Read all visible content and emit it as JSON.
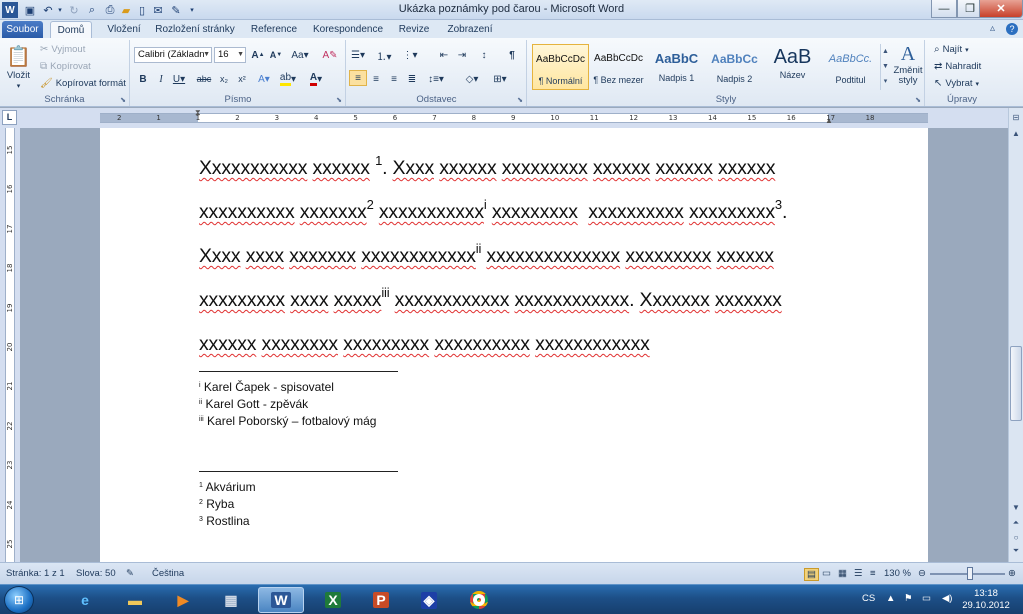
{
  "window": {
    "title": "Ukázka poznámky pod čarou - Microsoft Word",
    "controls": [
      "minimize-icon",
      "maximize-icon",
      "close-icon"
    ]
  },
  "tabs": [
    {
      "label": "Soubor"
    },
    {
      "label": "Domů"
    },
    {
      "label": "Vložení"
    },
    {
      "label": "Rozložení stránky"
    },
    {
      "label": "Reference"
    },
    {
      "label": "Korespondence"
    },
    {
      "label": "Revize"
    },
    {
      "label": "Zobrazení"
    }
  ],
  "ribbon": {
    "clipboard": {
      "label": "Schránka",
      "paste": "Vložit",
      "cut": "Vyjmout",
      "copy": "Kopírovat",
      "format_painter": "Kopírovat formát"
    },
    "font": {
      "label": "Písmo",
      "font_name": "Calibri (Základn",
      "font_size": "16"
    },
    "paragraph": {
      "label": "Odstavec"
    },
    "styles": {
      "label": "Styly",
      "items": [
        {
          "preview": "AaBbCcDc",
          "name": "¶ Normální"
        },
        {
          "preview": "AaBbCcDc",
          "name": "¶ Bez mezer"
        },
        {
          "preview": "AaBbC",
          "name": "Nadpis 1"
        },
        {
          "preview": "AaBbCc",
          "name": "Nadpis 2"
        },
        {
          "preview": "AaB",
          "name": "Název"
        },
        {
          "preview": "AaBbCc.",
          "name": "Podtitul"
        }
      ],
      "change_styles": "Změnit styly"
    },
    "editing": {
      "label": "Úpravy",
      "find": "Najít",
      "replace": "Nahradit",
      "select": "Vybrat"
    }
  },
  "ruler": {
    "ticks": [
      "2",
      "1",
      "1",
      "2",
      "3",
      "4",
      "5",
      "6",
      "7",
      "8",
      "9",
      "10",
      "11",
      "12",
      "13",
      "14",
      "15",
      "16",
      "17",
      "18"
    ],
    "vticks": [
      "15",
      "16",
      "17",
      "18",
      "19",
      "20",
      "21",
      "22",
      "23",
      "24",
      "25"
    ]
  },
  "document": {
    "lines": [
      [
        {
          "t": "Xxxxxxxxxxx"
        },
        {
          "t": " "
        },
        {
          "t": "xxxxxx"
        },
        {
          "t": " "
        },
        {
          "sup": "1"
        },
        {
          "t": ". "
        },
        {
          "t": "Xxxx"
        },
        {
          "t": " "
        },
        {
          "t": "xxxxxx"
        },
        {
          "t": " "
        },
        {
          "t": "xxxxxxxxx"
        },
        {
          "t": " "
        },
        {
          "t": "xxxxxx"
        },
        {
          "t": " "
        },
        {
          "t": "xxxxxx"
        },
        {
          "t": " "
        },
        {
          "t": "xxxxxx"
        }
      ],
      [
        {
          "t": "xxxxxxxxxx"
        },
        {
          "t": " "
        },
        {
          "t": "xxxxxxx"
        },
        {
          "sup": "2"
        },
        {
          "t": " "
        },
        {
          "t": "xxxxxxxxxxx"
        },
        {
          "sup": "i"
        },
        {
          "t": " "
        },
        {
          "t": "xxxxxxxxx"
        },
        {
          "t": "  "
        },
        {
          "t": "xxxxxxxxxx"
        },
        {
          "t": " "
        },
        {
          "t": "xxxxxxxxx"
        },
        {
          "sup": "3"
        },
        {
          "t": "."
        }
      ],
      [
        {
          "t": "Xxxx"
        },
        {
          "t": " "
        },
        {
          "t": "xxxx"
        },
        {
          "t": " "
        },
        {
          "t": "xxxxxxx"
        },
        {
          "t": " "
        },
        {
          "t": "xxxxxxxxxxxx"
        },
        {
          "sup": "ii"
        },
        {
          "t": " "
        },
        {
          "t": "xxxxxxxxxxxxxx"
        },
        {
          "t": " "
        },
        {
          "t": "xxxxxxxxx"
        },
        {
          "t": " "
        },
        {
          "t": "xxxxxx"
        }
      ],
      [
        {
          "t": "xxxxxxxxx"
        },
        {
          "t": " "
        },
        {
          "t": "xxxx"
        },
        {
          "t": " "
        },
        {
          "t": "xxxxx"
        },
        {
          "sup": "iii"
        },
        {
          "t": " "
        },
        {
          "t": "xxxxxxxxxxxx"
        },
        {
          "t": " "
        },
        {
          "t": "xxxxxxxxxxxx"
        },
        {
          "t": ". "
        },
        {
          "t": "Xxxxxxx"
        },
        {
          "t": " "
        },
        {
          "t": "xxxxxxx"
        }
      ],
      [
        {
          "t": "xxxxxx"
        },
        {
          "t": " "
        },
        {
          "t": "xxxxxxxx"
        },
        {
          "t": " "
        },
        {
          "t": "xxxxxxxxx"
        },
        {
          "t": " "
        },
        {
          "t": "xxxxxxxxxx"
        },
        {
          "t": " "
        },
        {
          "t": "xxxxxxxxxxxx"
        }
      ]
    ],
    "endnotes": [
      {
        "mark": "i",
        "text": "Karel Čapek - spisovatel"
      },
      {
        "mark": "ii",
        "text": "Karel Gott - zpěvák"
      },
      {
        "mark": "iii",
        "text": "Karel Poborský – fotbalový mág"
      }
    ],
    "footnotes": [
      {
        "mark": "1",
        "text": "Akvárium"
      },
      {
        "mark": "2",
        "text": "Ryba"
      },
      {
        "mark": "3",
        "text": "Rostlina"
      }
    ]
  },
  "statusbar": {
    "page": "Stránka: 1 z 1",
    "words": "Slova: 50",
    "language": "Čeština",
    "zoom": "130 %",
    "zoom_value": 130
  },
  "taskbar": {
    "apps": [
      "internet-explorer-icon",
      "explorer-icon",
      "media-player-icon",
      "calculator-icon",
      "word-icon",
      "excel-icon",
      "powerpoint-icon",
      "network-app-icon",
      "chrome-icon"
    ],
    "language": "CS",
    "time": "13:18",
    "date": "29.10.2012"
  },
  "colors": {
    "accent": "#2a5ba8",
    "spellcheck": "#e03030",
    "taskbar": "#1d4f87"
  }
}
